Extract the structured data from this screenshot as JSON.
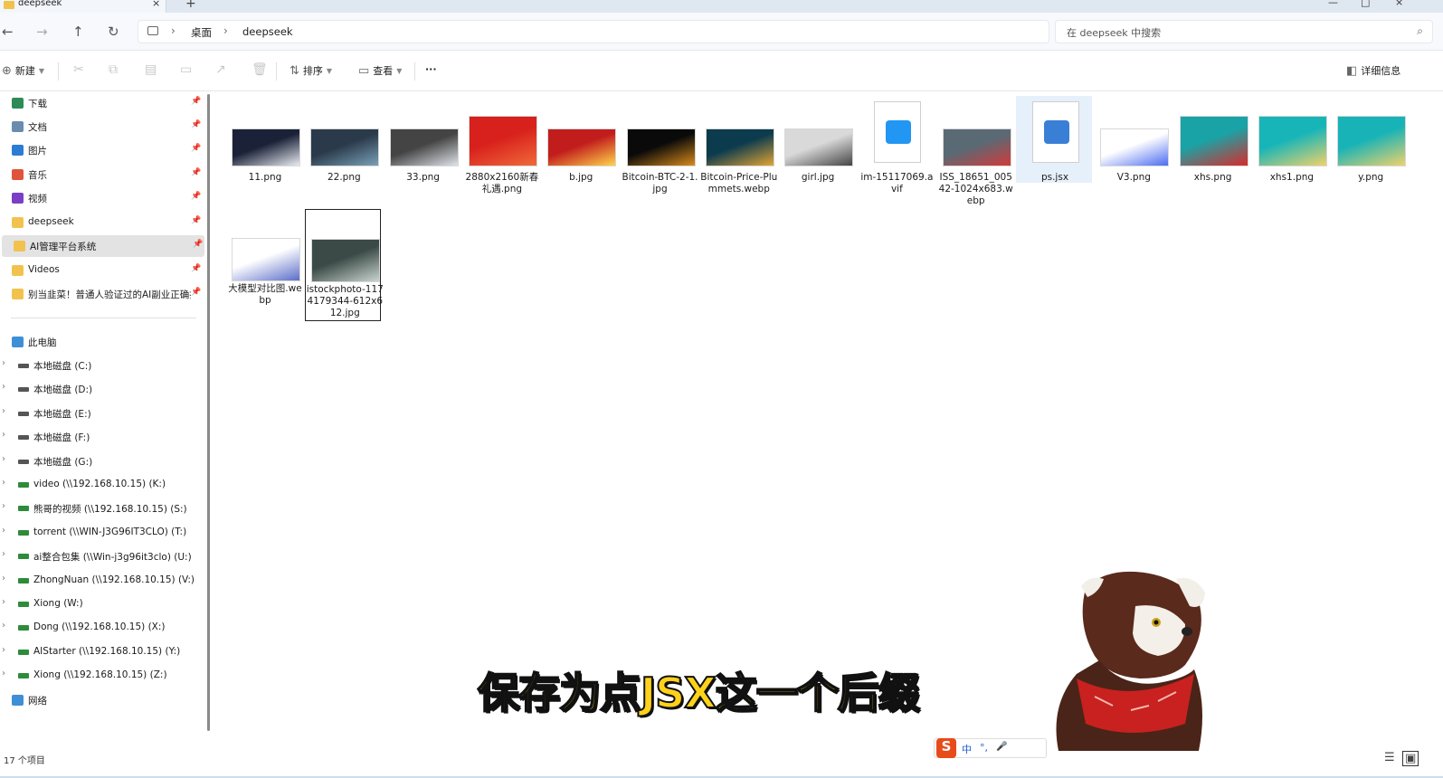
{
  "window": {
    "tab_title": "deepseek",
    "close_tab": "×",
    "new_tab": "+",
    "min": "—",
    "max": "□",
    "close": "×"
  },
  "nav": {
    "back": "←",
    "forward": "→",
    "up": "↑",
    "refresh": "↻",
    "breadcrumb": [
      "桌面",
      "deepseek"
    ],
    "breadcrumb_sep": "›",
    "search_placeholder": "在 deepseek 中搜索"
  },
  "toolbar": {
    "new_label": "新建",
    "sort_label": "排序",
    "view_label": "查看",
    "more_label": "···",
    "details_label": "详细信息"
  },
  "sidebar": {
    "quick_access": [
      {
        "label": "下载",
        "icon": "download-icon",
        "color": "#2e8b57"
      },
      {
        "label": "文档",
        "icon": "document-icon",
        "color": "#6a8caf"
      },
      {
        "label": "图片",
        "icon": "pictures-icon",
        "color": "#2b7cd3"
      },
      {
        "label": "音乐",
        "icon": "music-icon",
        "color": "#e0533c"
      },
      {
        "label": "视频",
        "icon": "video-icon",
        "color": "#7a3fc4"
      },
      {
        "label": "deepseek",
        "icon": "folder-icon",
        "color": "#f1c34e"
      },
      {
        "label": "AI管理平台系统",
        "icon": "folder-icon",
        "color": "#f1c34e"
      },
      {
        "label": "Videos",
        "icon": "folder-icon",
        "color": "#f1c34e"
      },
      {
        "label": "别当韭菜！普通人验证过的AI副业正确打开",
        "icon": "folder-icon",
        "color": "#f1c34e"
      }
    ],
    "this_pc": "此电脑",
    "drives": [
      "本地磁盘 (C:)",
      "本地磁盘 (D:)",
      "本地磁盘 (E:)",
      "本地磁盘 (F:)",
      "本地磁盘 (G:)",
      "video (\\\\192.168.10.15) (K:)",
      "熊哥的视频 (\\\\192.168.10.15) (S:)",
      "torrent (\\\\WIN-J3G96IT3CLO) (T:)",
      "ai整合包集 (\\\\Win-j3g96it3clo) (U:)",
      "ZhongNuan (\\\\192.168.10.15) (V:)",
      "Xiong (W:)",
      "Dong (\\\\192.168.10.15) (X:)",
      "AIStarter (\\\\192.168.10.15) (Y:)",
      "Xiong (\\\\192.168.10.15) (Z:)"
    ],
    "network": "网络",
    "pin": "📌",
    "chevron": "›"
  },
  "files": [
    {
      "name": "11.png",
      "colors": [
        "#1b2238",
        "#e9ecf2"
      ]
    },
    {
      "name": "22.png",
      "colors": [
        "#2a3a4a",
        "#7aa0b8"
      ]
    },
    {
      "name": "33.png",
      "colors": [
        "#444",
        "#dfe4ea"
      ]
    },
    {
      "name": "2880x2160新春礼遇.png",
      "colors": [
        "#d8201c",
        "#f06a3a"
      ]
    },
    {
      "name": "b.jpg",
      "colors": [
        "#c21d1d",
        "#ffd54a"
      ]
    },
    {
      "name": "Bitcoin-BTC-2-1.jpg",
      "colors": [
        "#0a0a0a",
        "#d98b1a"
      ]
    },
    {
      "name": "Bitcoin-Price-Plummets.webp",
      "colors": [
        "#0c3b4e",
        "#e2a534"
      ]
    },
    {
      "name": "girl.jpg",
      "colors": [
        "#d9d9d9",
        "#444"
      ]
    },
    {
      "name": "im-15117069.avif",
      "colors": [
        "#ffffff",
        "#2196f3"
      ]
    },
    {
      "name": "ISS_18651_00542-1024x683.webp",
      "colors": [
        "#5a6a75",
        "#d13a3a"
      ]
    },
    {
      "name": "ps.jsx",
      "colors": [
        "#ffffff",
        "#3a7fd6"
      ]
    },
    {
      "name": "V3.png",
      "colors": [
        "#ffffff",
        "#4b6cf0"
      ]
    },
    {
      "name": "xhs.png",
      "colors": [
        "#1aa3a6",
        "#d92a2a"
      ]
    },
    {
      "name": "xhs1.png",
      "colors": [
        "#17b5b8",
        "#f0d26a"
      ]
    },
    {
      "name": "y.png",
      "colors": [
        "#17b3b7",
        "#f0d26a"
      ]
    },
    {
      "name": "大模型对比图.webp",
      "colors": [
        "#ffffff",
        "#5b6ec8"
      ]
    },
    {
      "name": "istockphoto-1174179344-612x612.jpg",
      "colors": [
        "#3b4a46",
        "#c9d4cf"
      ]
    }
  ],
  "status": {
    "item_count": "17 个项目"
  },
  "subtitle": "保存为点JSX这一个后缀",
  "ime": {
    "logo": "S",
    "lang": "中",
    "punct": "°,",
    "mic": "🎤"
  }
}
